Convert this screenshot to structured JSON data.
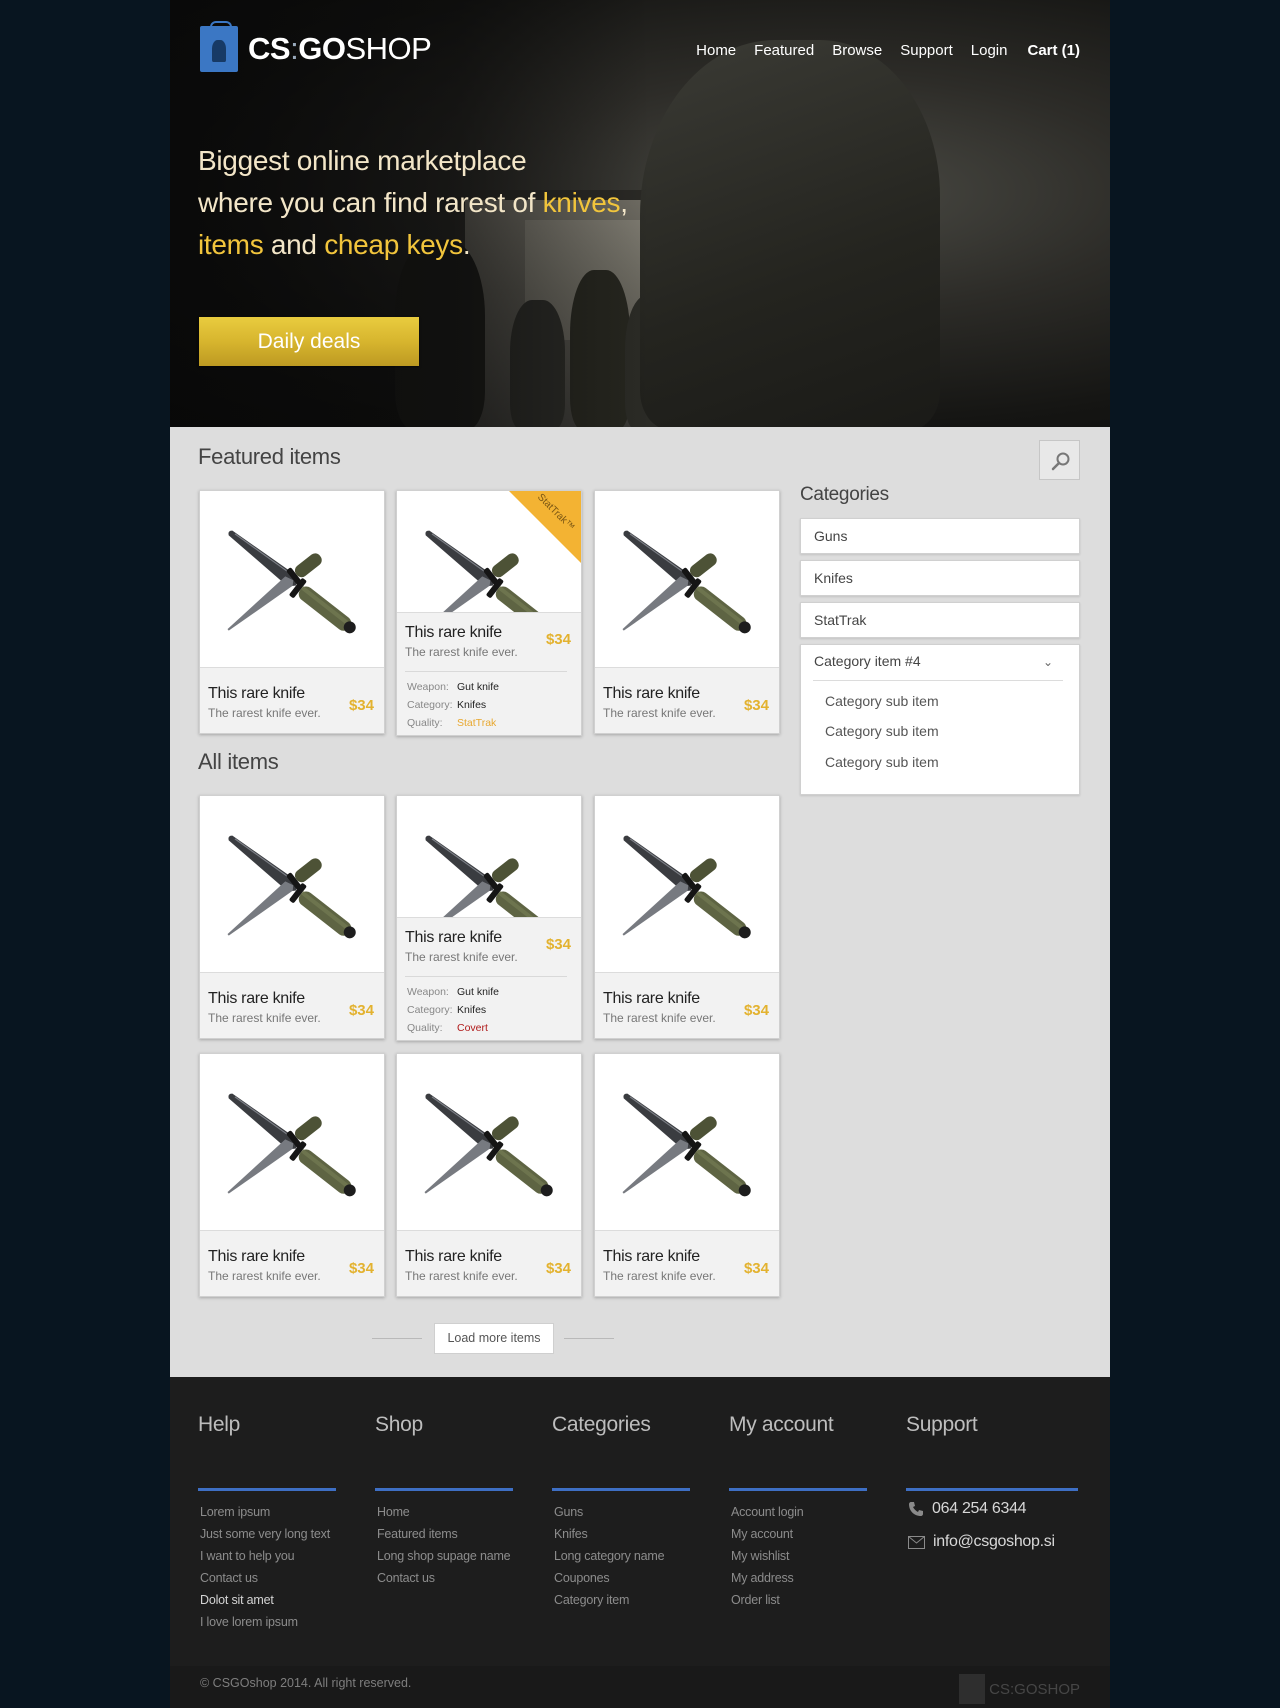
{
  "header": {
    "logo": {
      "part1": "CS",
      "colon": ":",
      "part2": "GO",
      "part3": "SHOP"
    },
    "nav": [
      "Home",
      "Featured",
      "Browse",
      "Support",
      "Login"
    ],
    "cart": "Cart (1)"
  },
  "hero": {
    "line1": "Biggest online marketplace",
    "line2_a": "where you can find rarest of ",
    "line2_hl": "knives",
    "line2_b": ",",
    "line3_hl1": "items",
    "line3_a": " and ",
    "line3_hl2": "cheap keys",
    "line3_b": ".",
    "cta": "Daily deals"
  },
  "featured": {
    "title": "Featured items",
    "items": [
      {
        "title": "This rare knife",
        "subtitle": "The rarest knife ever.",
        "price": "$34"
      },
      {
        "title": "This rare knife",
        "subtitle": "The rarest knife ever.",
        "price": "$34",
        "badge": "StatTrak™",
        "details": [
          {
            "k": "Weapon:",
            "v": "Gut knife"
          },
          {
            "k": "Category:",
            "v": "Knifes"
          },
          {
            "k": "Quality:",
            "v": "StatTrak"
          }
        ]
      },
      {
        "title": "This rare knife",
        "subtitle": "The rarest knife ever.",
        "price": "$34"
      }
    ]
  },
  "all": {
    "title": "All items",
    "items": [
      {
        "title": "This rare knife",
        "subtitle": "The rarest knife ever.",
        "price": "$34"
      },
      {
        "title": "This rare knife",
        "subtitle": "The rarest knife ever.",
        "price": "$34",
        "details": [
          {
            "k": "Weapon:",
            "v": "Gut knife"
          },
          {
            "k": "Category:",
            "v": "Knifes"
          },
          {
            "k": "Quality:",
            "v": "Covert"
          }
        ]
      },
      {
        "title": "This rare knife",
        "subtitle": "The rarest knife ever.",
        "price": "$34"
      },
      {
        "title": "This rare knife",
        "subtitle": "The rarest knife ever.",
        "price": "$34"
      },
      {
        "title": "This rare knife",
        "subtitle": "The rarest knife ever.",
        "price": "$34"
      },
      {
        "title": "This rare knife",
        "subtitle": "The rarest knife ever.",
        "price": "$34"
      }
    ],
    "load_more": "Load more items"
  },
  "categories": {
    "title": "Categories",
    "items": [
      "Guns",
      "Knifes",
      "StatTrak"
    ],
    "open_item": "Category item #4",
    "sub_items": [
      "Category sub item",
      "Category sub item",
      "Category sub item"
    ]
  },
  "footer": {
    "help": {
      "title": "Help",
      "links": [
        "Lorem ipsum",
        "Just some very long text",
        "I want to help you",
        "Contact us",
        "Dolot sit amet",
        "I love lorem ipsum"
      ]
    },
    "shop": {
      "title": "Shop",
      "links": [
        "Home",
        "Featured items",
        "Long shop supage name",
        "Contact us"
      ]
    },
    "categories": {
      "title": "Categories",
      "links": [
        "Guns",
        "Knifes",
        "Long category name",
        "Coupones",
        "Category  item"
      ]
    },
    "account": {
      "title": "My account",
      "links": [
        "Account login",
        "My account",
        "My wishlist",
        "My address",
        "Order list"
      ]
    },
    "support": {
      "title": "Support",
      "phone": "064 254 6344",
      "email": "info@csgoshop.si"
    },
    "copyright": "© CSGOshop 2014. All right reserved.",
    "logo_text": "CS:GOSHOP"
  },
  "colors": {
    "accent": "#f2c53c",
    "price": "#e3b22f",
    "footer_bar": "#3e6fc4",
    "covert": "#b01a1a",
    "stattrak": "#e8a830"
  },
  "icons": {
    "search": "search-icon",
    "chevron": "chevron-down-icon",
    "phone": "phone-icon",
    "mail": "mail-icon"
  }
}
